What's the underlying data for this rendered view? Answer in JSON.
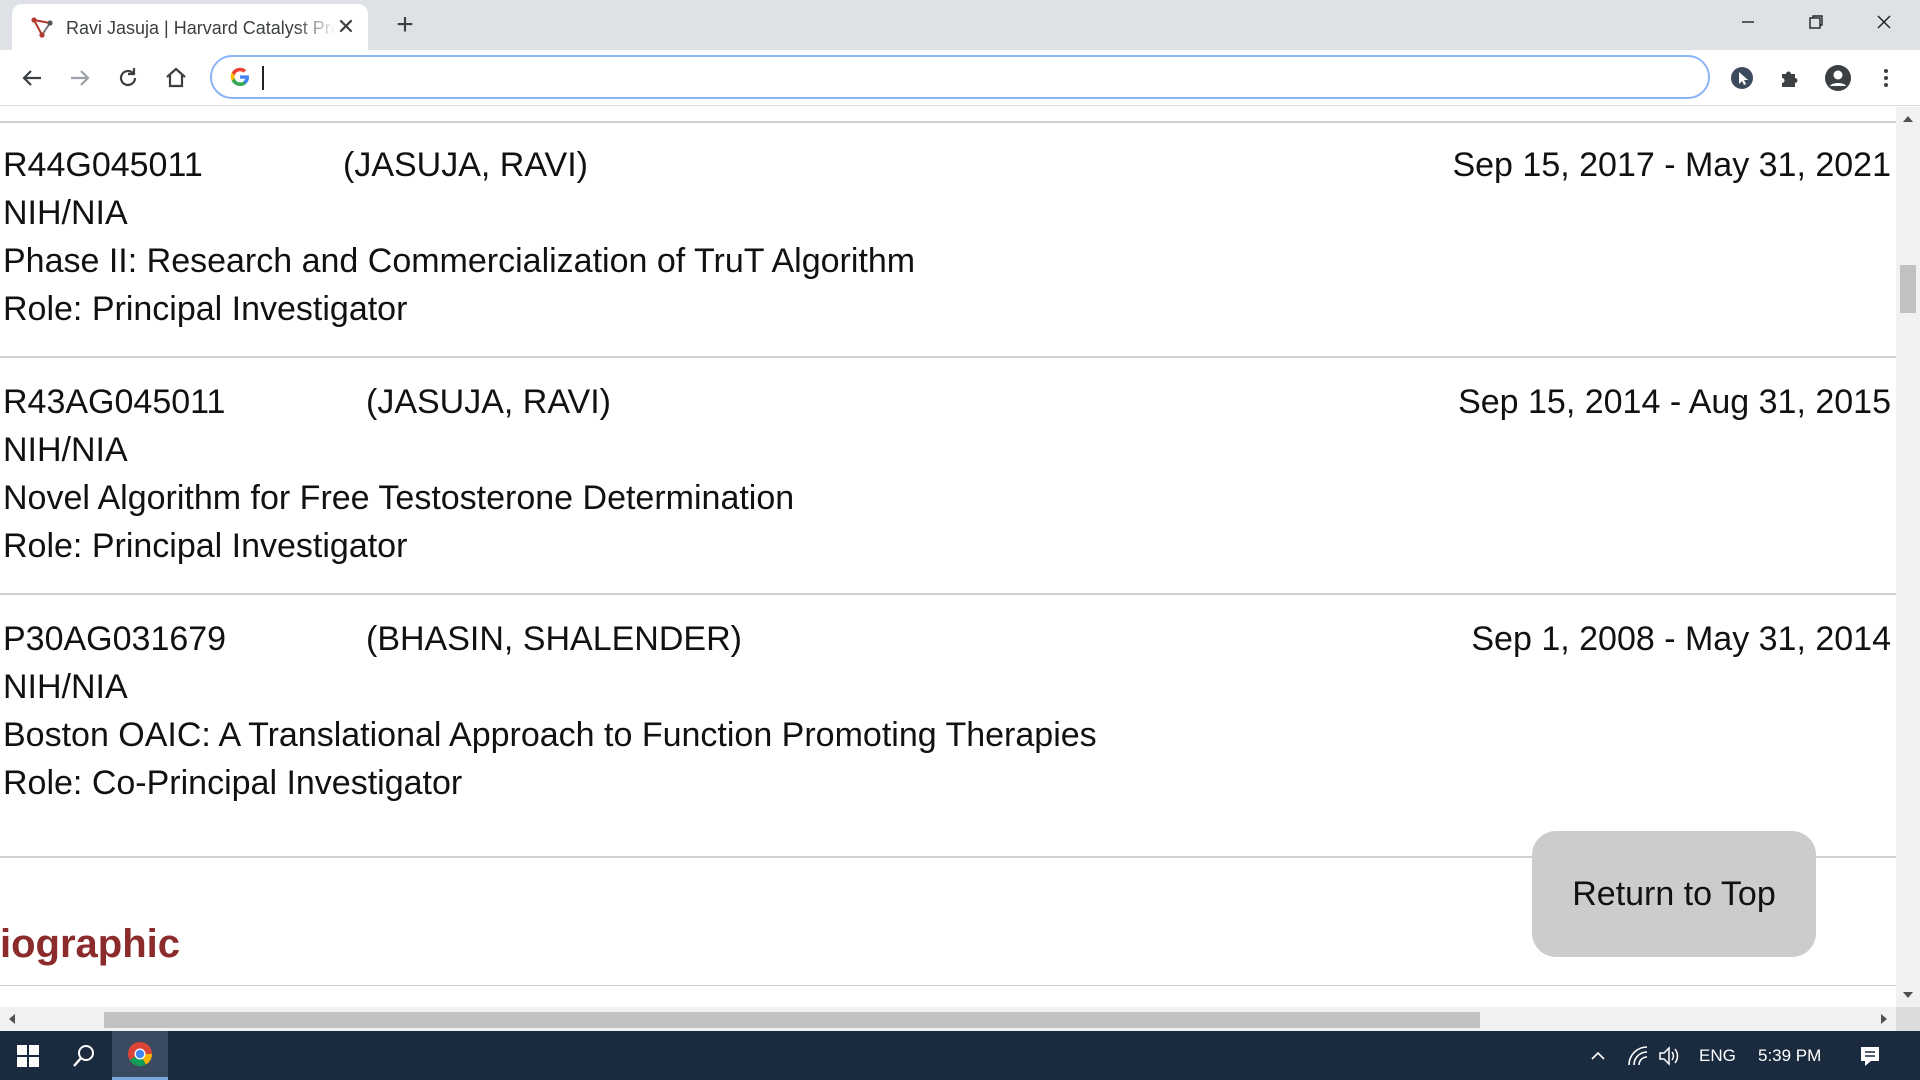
{
  "browser": {
    "tab_title": "Ravi Jasuja | Harvard Catalyst Profiles | Harvard Catalyst",
    "tab_close": "✕",
    "new_tab": "+",
    "address_value": "",
    "address_placeholder": ""
  },
  "grants": [
    {
      "id": "R44G045011",
      "pi": "(JASUJA, RAVI)",
      "dates": "Sep 15, 2017 - May 31, 2021",
      "agency": "NIH/NIA",
      "title": "Phase II: Research and Commercialization of TruT Algorithm",
      "role": "Role: Principal Investigator"
    },
    {
      "id": "R43AG045011",
      "pi": "(JASUJA, RAVI)",
      "dates": "Sep 15, 2014 - Aug 31, 2015",
      "agency": "NIH/NIA",
      "title": "Novel Algorithm for Free Testosterone Determination",
      "role": "Role: Principal Investigator"
    },
    {
      "id": "P30AG031679",
      "pi": "(BHASIN, SHALENDER)",
      "dates": "Sep 1, 2008 - May 31, 2014",
      "agency": "NIH/NIA",
      "title": "Boston OAIC: A Translational Approach to Function Promoting Therapies",
      "role": "Role: Co-Principal Investigator"
    }
  ],
  "section_heading": "iographic",
  "return_to_top": "Return to Top",
  "taskbar": {
    "language": "ENG",
    "time": "5:39 PM"
  },
  "colors": {
    "heading": "#8b2b2b",
    "taskbar": "#1b2b3f",
    "tabstrip": "#dee1e6",
    "omnibox_focus": "#8ab4f8"
  }
}
